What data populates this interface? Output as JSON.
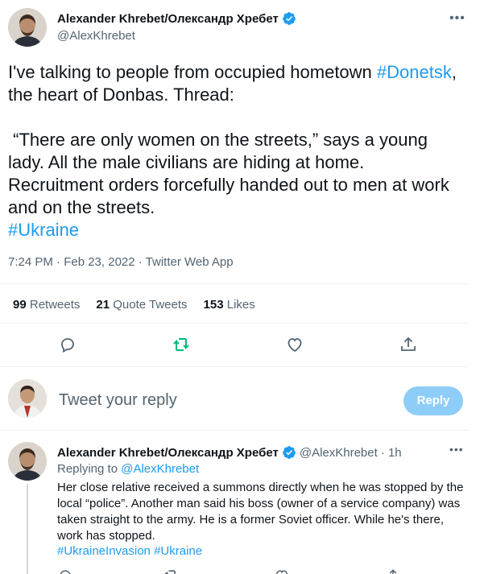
{
  "tweet": {
    "author_name": "Alexander Khrebet/Олександр Хребет",
    "handle": "@AlexKhrebet",
    "text_intro": "I've talking to people from occupied hometown ",
    "hashtag_donetsk": "#Donetsk",
    "text_after_hashtag": ", the heart of Donbas. Thread:",
    "text_body": "\n\n “There are only women on the streets,” says a young lady. All the male civilians are hiding at home. Recruitment orders forcefully handed out to men at work and on the streets.\n",
    "hashtag_ukraine": "#Ukraine",
    "meta": "7:24 PM · Feb 23, 2022 · Twitter Web App",
    "stats": {
      "retweets_count": "99",
      "retweets_label": "Retweets",
      "quote_count": "21",
      "quote_label": "Quote Tweets",
      "likes_count": "153",
      "likes_label": "Likes"
    },
    "accent_color": "#1d9bf0",
    "retweet_icon_color": "#00ba7c",
    "icons": [
      "reply-icon",
      "retweet-icon",
      "like-icon",
      "share-icon"
    ]
  },
  "reply_box": {
    "placeholder": "Tweet your reply",
    "button_label": "Reply"
  },
  "thread_tweet": {
    "author_name": "Alexander Khrebet/Олександр Хребет",
    "handle": "@AlexKhrebet",
    "time": " · 1h",
    "replying_label": "Replying to ",
    "replying_handle": "@AlexKhrebet",
    "text": "Her close relative received a summons directly when he was stopped by the local “police”.  Another man said his boss (owner of a service company) was taken straight to the army. He is a former Soviet officer. While he's there, work has stopped.",
    "hashtag_invasion": "#UkraineInvasion",
    "hashtag_ukraine": "#Ukraine"
  }
}
